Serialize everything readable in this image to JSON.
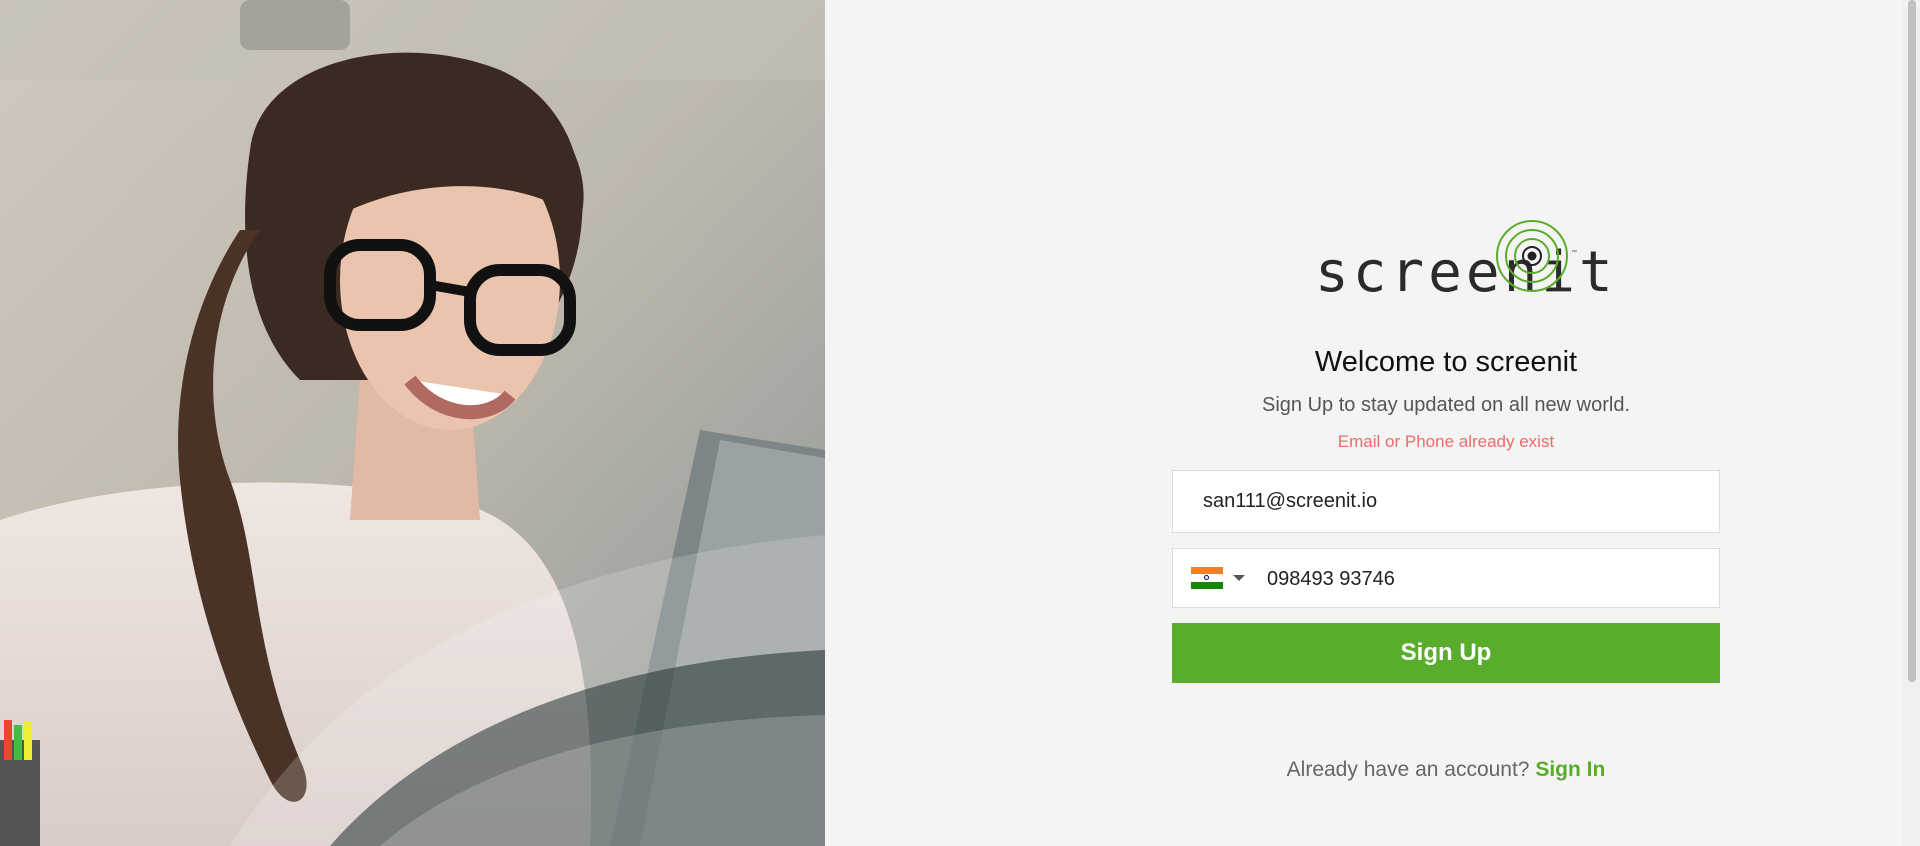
{
  "brand": {
    "logo_text": "screenit",
    "trademark": "™",
    "accent_color": "#5aad2c"
  },
  "hero": {
    "description_icon": "woman-with-glasses-photo"
  },
  "form": {
    "title": "Welcome to screenit",
    "subtitle": "Sign Up to stay updated on all new world.",
    "error_message": "Email or Phone already exist",
    "email_value": "san111@screenit.io",
    "phone_country_flag": "india-flag-icon",
    "phone_value": "098493 93746",
    "signup_label": "Sign Up",
    "error_color": "#ee6b6b"
  },
  "footer": {
    "account_prompt": "Already have an account?",
    "signin_label": "Sign In"
  }
}
